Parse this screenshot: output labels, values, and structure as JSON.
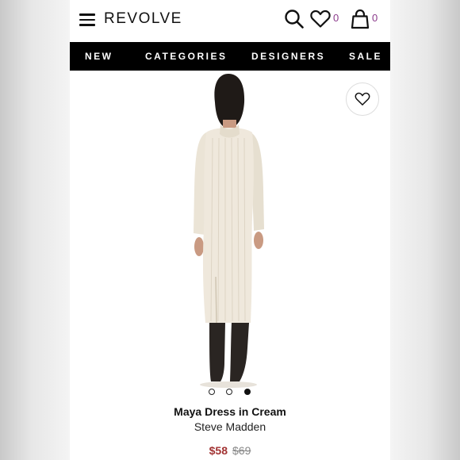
{
  "header": {
    "logo": "REVOLVE",
    "wishlist_count": "0",
    "bag_count": "0"
  },
  "nav": {
    "items": [
      "NEW",
      "CATEGORIES",
      "DESIGNERS",
      "SALE"
    ]
  },
  "gallery": {
    "image_count": 3,
    "active_index": 2
  },
  "product": {
    "name": "Maya Dress in Cream",
    "brand": "Steve Madden",
    "sale_price": "$58",
    "original_price": "$69"
  },
  "colors": {
    "nav_bg": "#000000",
    "sale_red": "#a23333",
    "count_purple": "#8b3a8b",
    "dress_cream": "#efe8dc",
    "boots": "#2a2522"
  },
  "icons": [
    "menu-icon",
    "search-icon",
    "heart-icon",
    "bag-icon"
  ]
}
